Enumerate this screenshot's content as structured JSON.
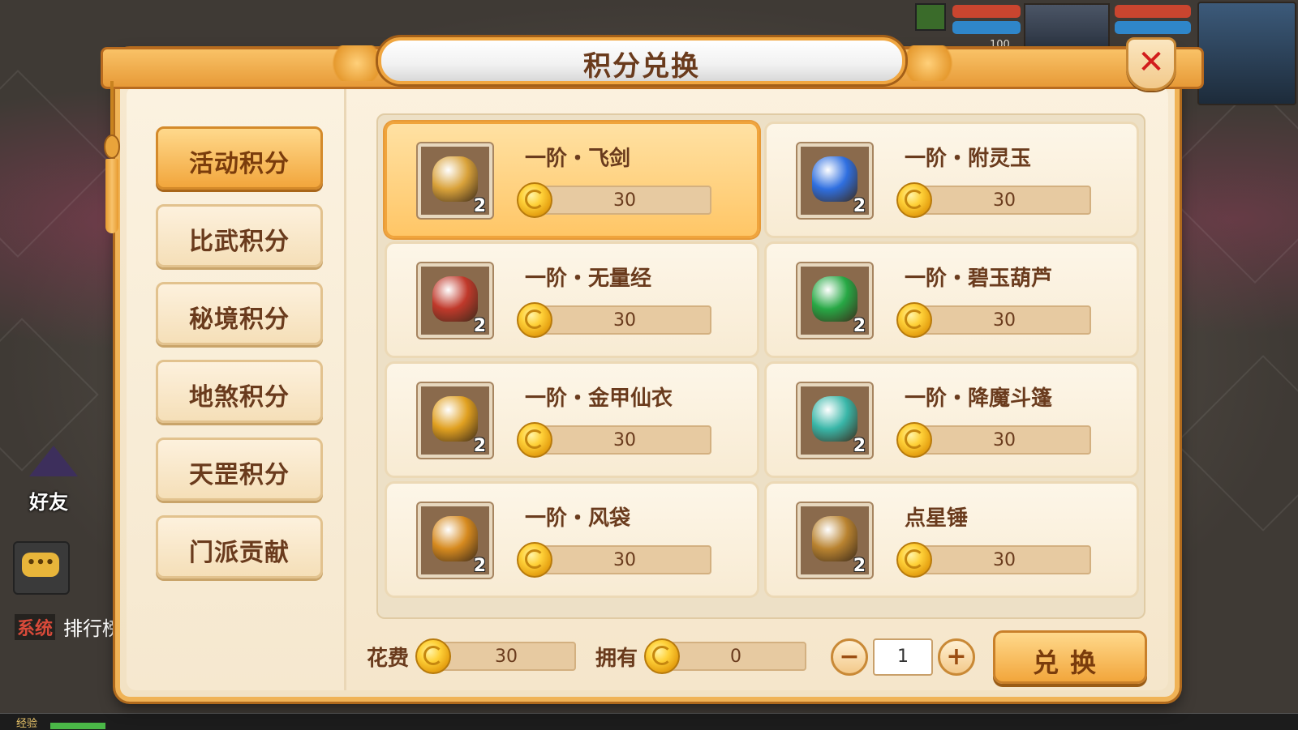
{
  "hud": {
    "level_num": "100"
  },
  "dialog": {
    "title": "积分兑换",
    "close_symbol": "✕"
  },
  "tabs": [
    {
      "label": "活动积分",
      "active": true
    },
    {
      "label": "比武积分",
      "active": false
    },
    {
      "label": "秘境积分",
      "active": false
    },
    {
      "label": "地煞积分",
      "active": false
    },
    {
      "label": "天罡积分",
      "active": false
    },
    {
      "label": "门派贡献",
      "active": false
    }
  ],
  "items": [
    {
      "name": "一阶・飞剑",
      "price": "30",
      "count": "2",
      "icon": "flying-sword-icon",
      "color": "#d9a23a",
      "selected": true
    },
    {
      "name": "一阶・附灵玉",
      "price": "30",
      "count": "2",
      "icon": "spirit-jade-icon",
      "color": "#2f6fe0",
      "selected": false
    },
    {
      "name": "一阶・无量经",
      "price": "30",
      "count": "2",
      "icon": "scroll-icon",
      "color": "#c0392b",
      "selected": false
    },
    {
      "name": "一阶・碧玉葫芦",
      "price": "30",
      "count": "2",
      "icon": "gourd-icon",
      "color": "#27a845",
      "selected": false
    },
    {
      "name": "一阶・金甲仙衣",
      "price": "30",
      "count": "2",
      "icon": "golden-armor-icon",
      "color": "#e0a020",
      "selected": false
    },
    {
      "name": "一阶・降魔斗篷",
      "price": "30",
      "count": "2",
      "icon": "cloak-icon",
      "color": "#39b6a8",
      "selected": false
    },
    {
      "name": "一阶・风袋",
      "price": "30",
      "count": "2",
      "icon": "wind-bag-icon",
      "color": "#d68a1f",
      "selected": false
    },
    {
      "name": "点星锤",
      "price": "30",
      "count": "2",
      "icon": "hammer-icon",
      "color": "#b98330",
      "selected": false
    }
  ],
  "footer": {
    "cost_label": "花费",
    "cost_value": "30",
    "owned_label": "拥有",
    "owned_value": "0",
    "minus_symbol": "−",
    "plus_symbol": "+",
    "quantity": "1",
    "exchange_label": "兑换"
  },
  "side_hud": {
    "friend_label": "好友",
    "chat_dots": "•••",
    "system_tag": "系统",
    "system_text": "排行榜",
    "exp_label": "经验"
  }
}
